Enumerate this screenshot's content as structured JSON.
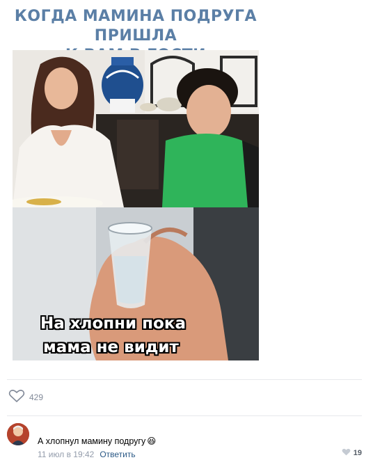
{
  "post": {
    "caption_line1": "КОГДА МАМИНА ПОДРУГА ПРИШЛА",
    "caption_line2": "К ВАМ В ГОСТИ",
    "subtitle_line1": "На хлопни пока",
    "subtitle_line2": "мама не видит",
    "likes_count": "429",
    "like_icon": "heart-outline-icon"
  },
  "comment": {
    "text": "А хлопнул мамину подругу",
    "emoji": "😆",
    "time": "11 июл в 19:42",
    "reply_label": "Ответить",
    "likes_count": "19",
    "like_icon": "heart-icon"
  },
  "colors": {
    "caption": "#5b7fa6",
    "link": "#2a5885",
    "meta": "#939cab",
    "divider": "#e7e8ec"
  }
}
